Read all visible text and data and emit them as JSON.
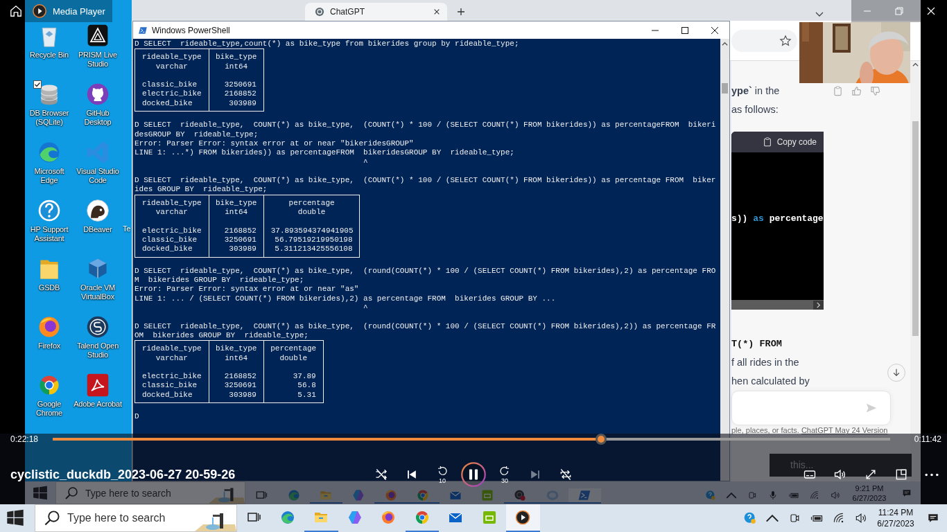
{
  "player": {
    "app_title": "Media Player",
    "video_title": "cyclistic_duckdb_2023-06-27 20-59-26",
    "elapsed": "0:22:18",
    "remaining": "0:11:42",
    "level": 0.655,
    "controls": [
      {
        "kind": "shuffle",
        "on": false,
        "disabled": false
      },
      {
        "kind": "previous",
        "disabled": false
      },
      {
        "kind": "back",
        "label": "10",
        "disabled": false
      },
      {
        "kind": "pause",
        "disabled": false
      },
      {
        "kind": "forward",
        "label": "30",
        "disabled": false
      },
      {
        "kind": "next",
        "disabled": true
      },
      {
        "kind": "repeat",
        "on": false,
        "disabled": false
      }
    ],
    "right_controls": [
      {
        "kind": "subtitles"
      },
      {
        "kind": "volume"
      },
      {
        "kind": "fullscreen"
      },
      {
        "kind": "mini"
      },
      {
        "kind": "more"
      }
    ]
  },
  "video": {
    "desktop_icons": [
      {
        "label": "Recycle Bin",
        "kind": "recycle",
        "checked": false
      },
      {
        "label": "PRISM Live Studio",
        "kind": "prism",
        "checked": false
      },
      {
        "label": "DB Browser (SQLite)",
        "kind": "dbbrowser",
        "checked": true
      },
      {
        "label": "GitHub Desktop",
        "kind": "github",
        "checked": false
      },
      {
        "label": "Microsoft Edge",
        "kind": "edge",
        "checked": false
      },
      {
        "label": "Visual Studio Code",
        "kind": "vscode",
        "checked": false
      },
      {
        "label": "HP Support Assistant",
        "kind": "hp",
        "checked": false
      },
      {
        "label": "DBeaver",
        "kind": "dbeaver",
        "checked": false
      },
      {
        "label": "GSDB",
        "kind": "folder",
        "checked": false
      },
      {
        "label": "Oracle VM VirtualBox",
        "kind": "virtualbox",
        "checked": false
      },
      {
        "label": "Firefox",
        "kind": "firefox",
        "checked": false
      },
      {
        "label": "Talend Open Studio",
        "kind": "talend",
        "checked": false
      },
      {
        "label": "Google Chrome",
        "kind": "chrome",
        "checked": false
      },
      {
        "label": "Adobe Acrobat",
        "kind": "acrobat",
        "checked": false
      }
    ],
    "hidden_icon_label": "Te",
    "browser": {
      "tab": "ChatGPT",
      "paragraphs": [
        {
          "text": "**ype`** in the"
        },
        {
          "text": "as follows:"
        }
      ],
      "code_block": {
        "copy_label": "Copy code",
        "tokens": [
          {
            "kind": "plain",
            "text": "s)) "
          },
          {
            "kind": "keyword",
            "text": "as"
          },
          {
            "kind": "plain",
            "text": " percentage"
          }
        ]
      },
      "paragraphs_after": [
        {
          "kind": "code",
          "text": "T(*) FROM"
        },
        {
          "kind": "text",
          "text": "f all rides in the"
        },
        {
          "kind": "text",
          "text": "hen calculated by"
        }
      ],
      "footer": {
        "text": "ple, places, or facts. ",
        "link": "ChatGPT May 24 Version"
      },
      "tooltip": "this..."
    },
    "powershell": {
      "title": "Windows PowerShell",
      "blocks": [
        {
          "kind": "text",
          "lines": [
            "D SELECT  rideable_type,count(*) as bike_type from bikerides group by rideable_type;"
          ]
        },
        {
          "kind": "table",
          "columns": [
            {
              "name": "rideable_type",
              "type": "varchar"
            },
            {
              "name": "bike_type",
              "type": "int64"
            }
          ],
          "rows": [
            [
              "classic_bike",
              "3250691"
            ],
            [
              "electric_bike",
              "2168852"
            ],
            [
              "docked_bike",
              "303989"
            ]
          ]
        },
        {
          "kind": "text",
          "lines": [
            "D SELECT  rideable_type,  COUNT(*) as bike_type,  (COUNT(*) * 100 / (SELECT COUNT(*) FROM bikerides)) as percentageFROM  bikeri",
            "desGROUP BY  rideable_type;",
            "Error: Parser Error: syntax error at or near \"bikeridesGROUP\"",
            "LINE 1: ...*) FROM bikerides)) as percentageFROM  bikeridesGROUP BY  rideable_type;",
            "                                                  ^"
          ]
        },
        {
          "kind": "text",
          "lines": [
            "D SELECT  rideable_type,  COUNT(*) as bike_type,  (COUNT(*) * 100 / (SELECT COUNT(*) FROM bikerides)) as percentage FROM  biker",
            "ides GROUP BY  rideable_type;"
          ]
        },
        {
          "kind": "table",
          "columns": [
            {
              "name": "rideable_type",
              "type": "varchar"
            },
            {
              "name": "bike_type",
              "type": "int64"
            },
            {
              "name": "percentage",
              "type": "double"
            }
          ],
          "rows": [
            [
              "electric_bike",
              "2168852",
              "37.893594374941905"
            ],
            [
              "classic_bike",
              "3250691",
              "56.79519219950198"
            ],
            [
              "docked_bike",
              "303989",
              "5.311213425556108"
            ]
          ]
        },
        {
          "kind": "text",
          "lines": [
            "D SELECT  rideable_type,  COUNT(*) as bike_type,  (round(COUNT(*) * 100 / (SELECT COUNT(*) FROM bikerides),2) as percentage FRO",
            "M  bikerides GROUP BY  rideable_type;",
            "Error: Parser Error: syntax error at or near \"as\"",
            "LINE 1: ... / (SELECT COUNT(*) FROM bikerides),2) as percentage FROM  bikerides GROUP BY ...",
            "                                                  ^"
          ]
        },
        {
          "kind": "text",
          "lines": [
            "D SELECT  rideable_type,  COUNT(*) as bike_type,  (round(COUNT(*) * 100 / (SELECT COUNT(*) FROM bikerides),2)) as percentage FR",
            "OM  bikerides GROUP BY  rideable_type;"
          ]
        },
        {
          "kind": "table",
          "columns": [
            {
              "name": "rideable_type",
              "type": "varchar"
            },
            {
              "name": "bike_type",
              "type": "int64"
            },
            {
              "name": "percentage",
              "type": "double"
            }
          ],
          "rows": [
            [
              "electric_bike",
              "2168852",
              "37.89"
            ],
            [
              "classic_bike",
              "3250691",
              "56.8"
            ],
            [
              "docked_bike",
              "303989",
              "5.31"
            ]
          ]
        },
        {
          "kind": "text",
          "lines": [
            "D"
          ]
        }
      ]
    },
    "taskbar": {
      "search_placeholder": "Type here to search",
      "apps": [
        {
          "kind": "taskview",
          "running": false,
          "selected": false
        },
        {
          "kind": "edge",
          "running": false,
          "selected": false
        },
        {
          "kind": "explorer",
          "running": true,
          "selected": false
        },
        {
          "kind": "copilot",
          "running": false,
          "selected": false
        },
        {
          "kind": "firefox",
          "running": true,
          "selected": false
        },
        {
          "kind": "chrome",
          "running": true,
          "selected": false
        },
        {
          "kind": "mail",
          "running": false,
          "selected": false
        },
        {
          "kind": "nvidia",
          "running": false,
          "selected": false
        },
        {
          "kind": "obs",
          "running": true,
          "selected": false
        },
        {
          "kind": "r",
          "running": true,
          "selected": false
        },
        {
          "kind": "powershell",
          "running": true,
          "selected": true
        }
      ],
      "time": "9:21 PM",
      "date": "6/27/2023"
    }
  },
  "taskbar": {
    "search_placeholder": "Type here to search",
    "apps": [
      {
        "kind": "taskview",
        "running": false,
        "selected": false
      },
      {
        "kind": "edge",
        "running": false,
        "selected": false
      },
      {
        "kind": "explorer",
        "running": true,
        "selected": false
      },
      {
        "kind": "copilot",
        "running": false,
        "selected": false
      },
      {
        "kind": "firefox",
        "running": false,
        "selected": false
      },
      {
        "kind": "chrome",
        "running": true,
        "selected": false
      },
      {
        "kind": "mail",
        "running": false,
        "selected": false
      },
      {
        "kind": "nvidia",
        "running": false,
        "selected": false
      },
      {
        "kind": "media",
        "running": true,
        "selected": true
      }
    ],
    "time": "11:24 PM",
    "date": "6/27/2023"
  }
}
